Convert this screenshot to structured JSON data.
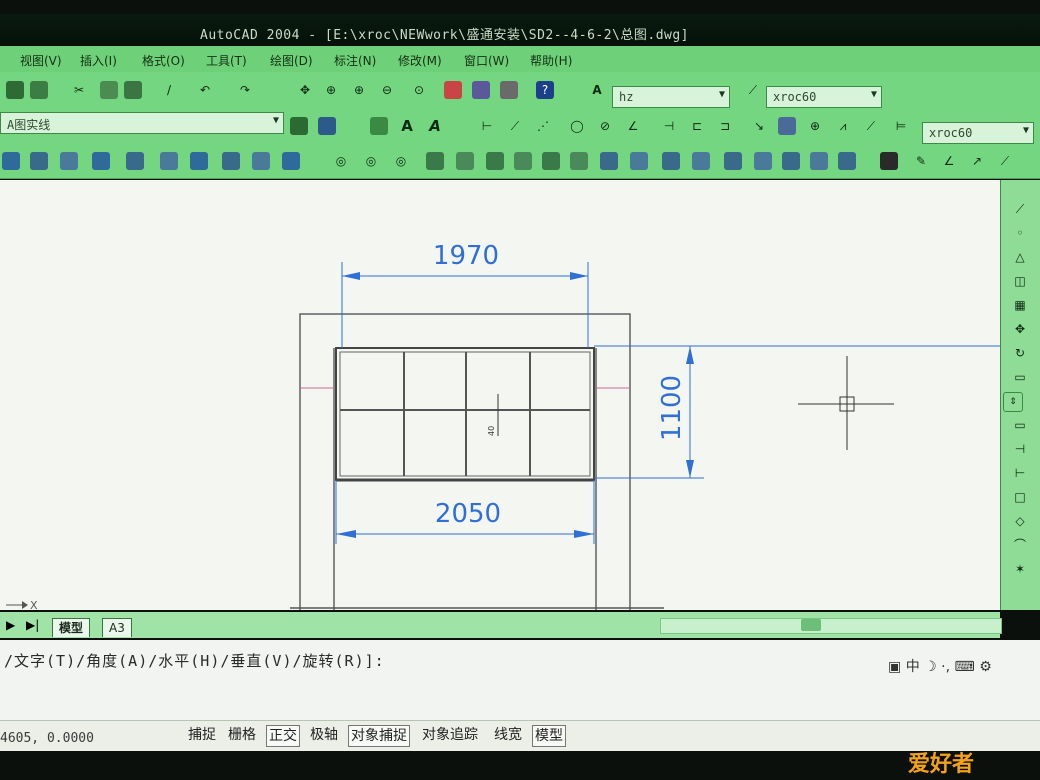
{
  "window": {
    "title": "AutoCAD 2004 - [E:\\xroc\\NEWwork\\盛通安装\\SD2--4-6-2\\总图.dwg]"
  },
  "menu": [
    "视图(V)",
    "插入(I)",
    "格式(O)",
    "工具(T)",
    "绘图(D)",
    "标注(N)",
    "修改(M)",
    "窗口(W)",
    "帮助(H)"
  ],
  "toolbar": {
    "textstyle_value": "hz",
    "dimstyle_value": "xroc60",
    "layer_value": "A图实线",
    "dimstyle2_value": "xroc60"
  },
  "drawing": {
    "dim_top": "1970",
    "dim_bottom": "2050",
    "dim_right": "1100",
    "small_label": "40"
  },
  "tabs": {
    "model": "模型",
    "layout": "A3"
  },
  "command": {
    "prompt": "/文字(T)/角度(A)/水平(H)/垂直(V)/旋转(R)]:"
  },
  "status": {
    "coordinates": "4605, 0.0000",
    "buttons": [
      "捕捉",
      "栅格",
      "正交",
      "极轴",
      "对象捕捉",
      "对象追踪",
      "线宽",
      "模型"
    ]
  },
  "tray": {
    "ime": "中"
  },
  "watermark": {
    "text": "爱好者"
  },
  "colors": {
    "toolbar_green": "#74d680",
    "dimension_blue": "#2f6fd6",
    "canvas": "#f4f6f2"
  }
}
